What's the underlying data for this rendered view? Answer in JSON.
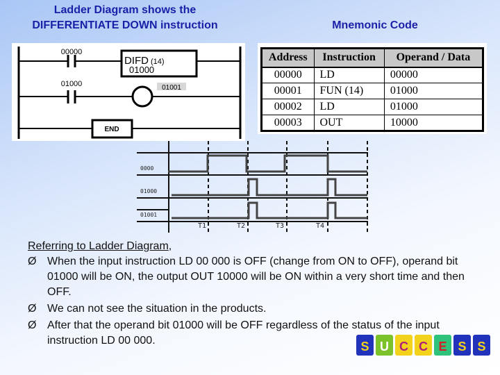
{
  "titles": {
    "ladder": "Ladder Diagram shows the",
    "ladder2": "DIFFERENTIATE DOWN instruction",
    "mnemonic": "Mnemonic Code"
  },
  "ladder": {
    "contact1": "00000",
    "instr": "DIFD",
    "instr_code": "(14)",
    "instr_operand": "01000",
    "contact2": "01000",
    "coil": "01001",
    "end": "END"
  },
  "table": {
    "headers": [
      "Address",
      "Instruction",
      "Operand / Data"
    ],
    "rows": [
      [
        "00000",
        "LD",
        "00000"
      ],
      [
        "00001",
        "FUN (14)",
        "01000"
      ],
      [
        "00002",
        "LD",
        "01000"
      ],
      [
        "00003",
        "OUT",
        "10000"
      ]
    ]
  },
  "timing": {
    "signals": [
      "0000",
      "01000",
      "01001"
    ],
    "times": [
      "T1",
      "T2",
      "T3",
      "T4"
    ]
  },
  "text": {
    "intro": "Referring to Ladder Diagram",
    "intro_tail": ",",
    "bullet_glyph": "Ø",
    "bullets": [
      "When the input instruction LD 00 000 is OFF (change from ON to OFF), operand bit 01000 will be ON, the output OUT 10000 will be ON within a very short time and then OFF.",
      "We can not see the situation in the products.",
      "After that the operand bit 01000 will be OFF regardless of the status of the input instruction LD 00 000."
    ]
  },
  "logo": {
    "letters": [
      "S",
      "U",
      "C",
      "C",
      "E",
      "S",
      "S"
    ],
    "colors": [
      "#2233bb",
      "#7cc22a",
      "#f2d21a",
      "#f2d21a",
      "#2fc27a",
      "#2233bb",
      "#2233bb"
    ],
    "letter_colors": [
      "#f2d21a",
      "#ffffff",
      "#b0207a",
      "#b0207a",
      "#d0202a",
      "#f2d21a",
      "#f2d21a"
    ]
  }
}
